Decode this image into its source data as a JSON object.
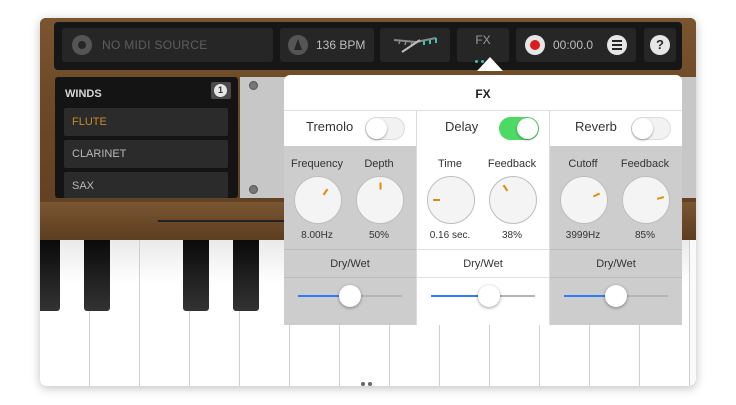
{
  "toolbar": {
    "midi_source": "NO MIDI SOURCE",
    "bpm": "136 BPM",
    "fx_label": "FX",
    "time": "00:00.0"
  },
  "presets": {
    "category": "WINDS",
    "count": "1",
    "items": [
      {
        "label": "FLUTE",
        "selected": true
      },
      {
        "label": "CLARINET",
        "selected": false
      },
      {
        "label": "SAX",
        "selected": false
      }
    ]
  },
  "fx": {
    "title": "FX",
    "dry_wet_label": "Dry/Wet",
    "effects": [
      {
        "name": "Tremolo",
        "enabled": false,
        "params": [
          {
            "label": "Frequency",
            "value": "8.00Hz"
          },
          {
            "label": "Depth",
            "value": "50%"
          }
        ],
        "dry_wet": 0.5
      },
      {
        "name": "Delay",
        "enabled": true,
        "params": [
          {
            "label": "Time",
            "value": "0.16 sec."
          },
          {
            "label": "Feedback",
            "value": "38%"
          }
        ],
        "dry_wet": 0.56
      },
      {
        "name": "Reverb",
        "enabled": false,
        "params": [
          {
            "label": "Cutoff",
            "value": "3999Hz"
          },
          {
            "label": "Feedback",
            "value": "85%"
          }
        ],
        "dry_wet": 0.5
      }
    ]
  },
  "colors": {
    "switch_on": "#4cd964",
    "slider_fill": "#2f7cf6",
    "knob_indicator": "#e08a10",
    "record": "#d81e1e"
  }
}
